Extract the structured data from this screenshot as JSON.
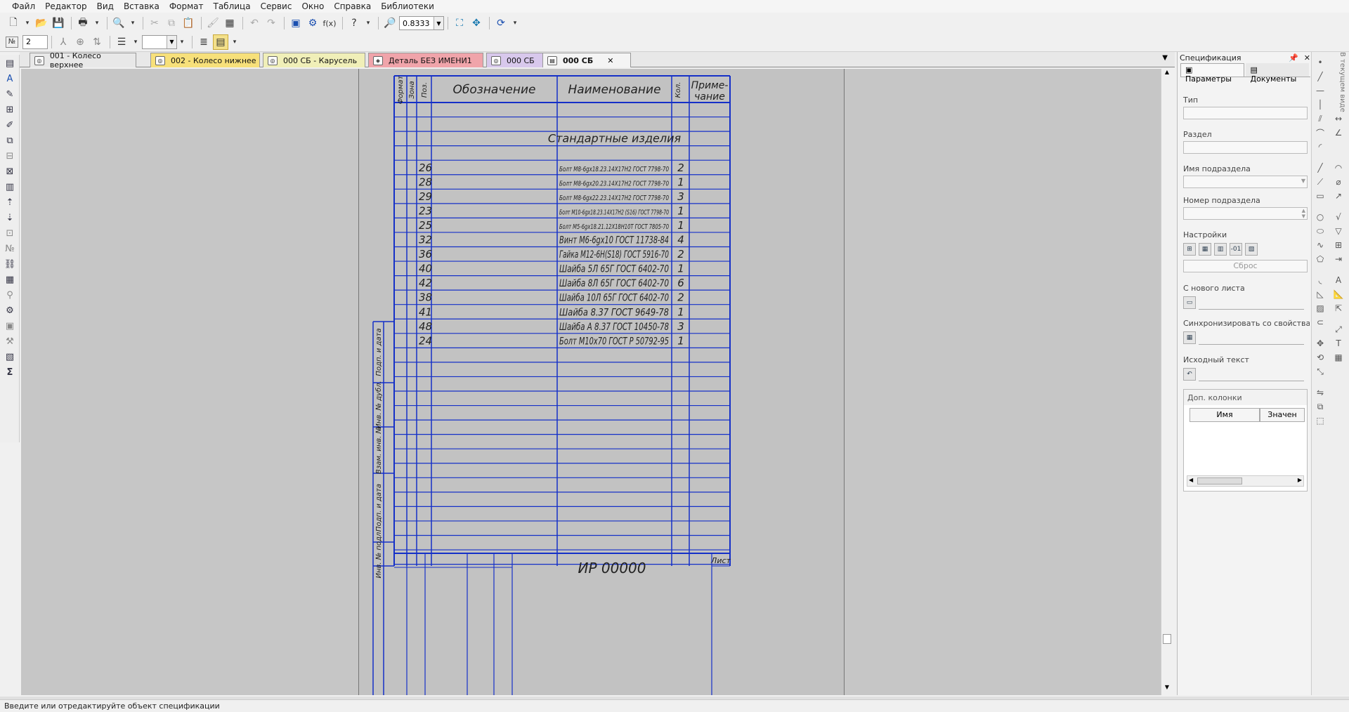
{
  "menu": [
    "Файл",
    "Редактор",
    "Вид",
    "Вставка",
    "Формат",
    "Таблица",
    "Сервис",
    "Окно",
    "Справка",
    "Библиотеки"
  ],
  "toolbar": {
    "zoom_value": "0.8333",
    "line_number": "2",
    "label_no": "№"
  },
  "tabs": [
    {
      "label": "001 - Колесо верхнее",
      "color": "#e8e8e8"
    },
    {
      "label": "002 - Колесо нижнее",
      "color": "#f7e07a"
    },
    {
      "label": "000 СБ - Карусель",
      "color": "#f0efb8"
    },
    {
      "label": "Деталь БЕЗ ИМЕНИ1",
      "color": "#f0a4aa"
    },
    {
      "label": "000 СБ",
      "color": "#d8c8ec"
    },
    {
      "label": "000 СБ",
      "color": "#f4f4f4",
      "active": true
    }
  ],
  "spec": {
    "header": {
      "format": "Формат",
      "zone": "Зона",
      "pos": "Поз.",
      "designation": "Обозначение",
      "name": "Наименование",
      "qty": "Кол.",
      "note": "Приме-чание"
    },
    "section_title": "Стандартные изделия",
    "rows": [
      {
        "pos": "26",
        "name": "Болт М8-6gх18.23.14Х17Н2 ГОСТ 7798-70",
        "qty": "2"
      },
      {
        "pos": "28",
        "name": "Болт М8-6gх20.23.14Х17Н2 ГОСТ 7798-70",
        "qty": "1"
      },
      {
        "pos": "29",
        "name": "Болт М8-6gх22.23.14Х17Н2 ГОСТ 7798-70",
        "qty": "3"
      },
      {
        "pos": "23",
        "name": "Болт М10-6gх18.23.14Х17Н2 (S16) ГОСТ 7798-70",
        "qty": "1"
      },
      {
        "pos": "25",
        "name": "Болт М5-6gх18.21.12Х18Н10Т ГОСТ 7805-70",
        "qty": "1"
      },
      {
        "pos": "32",
        "name": "Винт М6-6gх10 ГОСТ 11738-84",
        "qty": "4"
      },
      {
        "pos": "36",
        "name": "Гайка М12-6Н(S18) ГОСТ 5916-70",
        "qty": "2"
      },
      {
        "pos": "40",
        "name": "Шайба 5Л 65Г ГОСТ 6402-70",
        "qty": "1"
      },
      {
        "pos": "42",
        "name": "Шайба 8Л 65Г ГОСТ 6402-70",
        "qty": "6"
      },
      {
        "pos": "38",
        "name": "Шайба 10Л 65Г ГОСТ 6402-70",
        "qty": "2"
      },
      {
        "pos": "41",
        "name": "Шайба 8.37 ГОСТ 9649-78",
        "qty": "1"
      },
      {
        "pos": "48",
        "name": "Шайба А 8.37 ГОСТ 10450-78",
        "qty": "3"
      },
      {
        "pos": "24",
        "name": "Болт М10х70 ГОСТ Р 50792-95",
        "qty": "1"
      }
    ],
    "side_labels": [
      "Подп. и дата",
      "Инв. № дубл.",
      "Взам. инв. №",
      "Подп. и дата",
      "Инв. № подл."
    ],
    "stamp_designation": "ИР 00000",
    "stamp_sheet": "Лист"
  },
  "panel": {
    "title": "Спецификация",
    "tab_params": "Параметры",
    "tab_docs": "Документы",
    "type_label": "Тип",
    "section_label": "Раздел",
    "subsection_name_label": "Имя подраздела",
    "subsection_number_label": "Номер подраздела",
    "settings_label": "Настройки",
    "reset_label": "Сброс",
    "new_sheet_label": "С нового листа",
    "sync_label": "Синхронизировать со свойствами и",
    "source_text_label": "Исходный текст",
    "extra_columns_label": "Доп. колонки",
    "col_name": "Имя",
    "col_value": "Значен"
  },
  "right_strip_text": "В текущем виде",
  "status": "Введите или отредактируйте объект спецификации"
}
